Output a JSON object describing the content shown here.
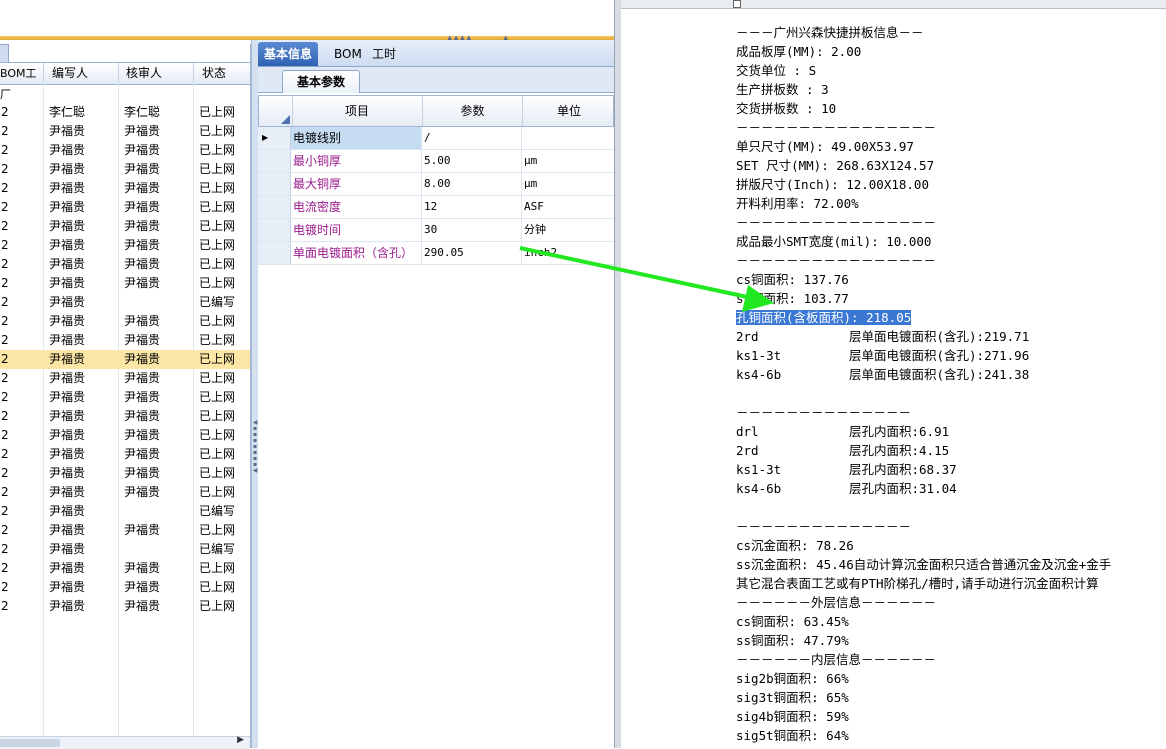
{
  "middle": {
    "tabs": [
      "基本信息",
      "BOM",
      "工时"
    ],
    "sub_tab": "基本参数",
    "grid_headers": [
      "项目",
      "参数",
      "单位"
    ],
    "rows": [
      {
        "item": "电镀线别",
        "value": "/",
        "unit": ""
      },
      {
        "item": "最小铜厚",
        "value": "5.00",
        "unit": "μm"
      },
      {
        "item": "最大铜厚",
        "value": "8.00",
        "unit": "μm"
      },
      {
        "item": "电流密度",
        "value": "12",
        "unit": "ASF"
      },
      {
        "item": "电镀时间",
        "value": "30",
        "unit": "分钟"
      },
      {
        "item": "单面电镀面积（含孔）",
        "value": "290.05",
        "unit": "inch2"
      }
    ]
  },
  "left": {
    "headers": [
      "BOM工厂",
      "编写人",
      "核审人",
      "状态"
    ],
    "rows": [
      [
        "2",
        "李仁聪",
        "李仁聪",
        "已上网"
      ],
      [
        "2",
        "尹福贵",
        "尹福贵",
        "已上网"
      ],
      [
        "2",
        "尹福贵",
        "尹福贵",
        "已上网"
      ],
      [
        "2",
        "尹福贵",
        "尹福贵",
        "已上网"
      ],
      [
        "2",
        "尹福贵",
        "尹福贵",
        "已上网"
      ],
      [
        "2",
        "尹福贵",
        "尹福贵",
        "已上网"
      ],
      [
        "2",
        "尹福贵",
        "尹福贵",
        "已上网"
      ],
      [
        "2",
        "尹福贵",
        "尹福贵",
        "已上网"
      ],
      [
        "2",
        "尹福贵",
        "尹福贵",
        "已上网"
      ],
      [
        "2",
        "尹福贵",
        "尹福贵",
        "已上网"
      ],
      [
        "2",
        "尹福贵",
        "",
        "已编写"
      ],
      [
        "2",
        "尹福贵",
        "尹福贵",
        "已上网"
      ],
      [
        "2",
        "尹福贵",
        "尹福贵",
        "已上网"
      ],
      [
        "2",
        "尹福贵",
        "尹福贵",
        "已上网"
      ],
      [
        "2",
        "尹福贵",
        "尹福贵",
        "已上网"
      ],
      [
        "2",
        "尹福贵",
        "尹福贵",
        "已上网"
      ],
      [
        "2",
        "尹福贵",
        "尹福贵",
        "已上网"
      ],
      [
        "2",
        "尹福贵",
        "尹福贵",
        "已上网"
      ],
      [
        "2",
        "尹福贵",
        "尹福贵",
        "已上网"
      ],
      [
        "2",
        "尹福贵",
        "尹福贵",
        "已上网"
      ],
      [
        "2",
        "尹福贵",
        "尹福贵",
        "已上网"
      ],
      [
        "2",
        "尹福贵",
        "",
        "已编写"
      ],
      [
        "2",
        "尹福贵",
        "尹福贵",
        "已上网"
      ],
      [
        "2",
        "尹福贵",
        "",
        "已编写"
      ],
      [
        "2",
        "尹福贵",
        "尹福贵",
        "已上网"
      ],
      [
        "2",
        "尹福贵",
        "尹福贵",
        "已上网"
      ],
      [
        "2",
        "尹福贵",
        "尹福贵",
        "已上网"
      ]
    ],
    "selected_row": 13
  },
  "report": {
    "lines": [
      {
        "text": "－－－广州兴森快捷拼板信息－－"
      },
      {
        "text": "成品板厚(MM): 2.00"
      },
      {
        "text": "交货单位 : S"
      },
      {
        "text": "生产拼板数 : 3"
      },
      {
        "text": "交货拼板数 : 10"
      },
      {
        "text": "－－－－－－－－－－－－－－－－"
      },
      {
        "text": "单只尺寸(MM): 49.00X53.97"
      },
      {
        "text": "SET 尺寸(MM): 268.63X124.57"
      },
      {
        "text": "拼版尺寸(Inch): 12.00X18.00"
      },
      {
        "text": "开料利用率: 72.00%"
      },
      {
        "text": "－－－－－－－－－－－－－－－－"
      },
      {
        "text": "成品最小SMT宽度(mil): 10.000"
      },
      {
        "text": "－－－－－－－－－－－－－－－－"
      },
      {
        "text": "cs铜面积: 137.76"
      },
      {
        "text": "ss铜面积: 103.77"
      },
      {
        "text": "孔铜面积(含板面积): 218.05",
        "highlight": true
      },
      {
        "k": "2rd",
        "v": "层单面电镀面积(含孔):219.71"
      },
      {
        "k": "ks1-3t",
        "v": "层单面电镀面积(含孔):271.96"
      },
      {
        "k": "ks4-6b",
        "v": "层单面电镀面积(含孔):241.38"
      },
      {
        "text": ""
      },
      {
        "text": "－－－－－－－－－－－－－－"
      },
      {
        "k": "drl",
        "v": "层孔内面积:6.91"
      },
      {
        "k": "2rd",
        "v": "层孔内面积:4.15"
      },
      {
        "k": "ks1-3t",
        "v": "层孔内面积:68.37"
      },
      {
        "k": "ks4-6b",
        "v": "层孔内面积:31.04"
      },
      {
        "text": ""
      },
      {
        "text": "－－－－－－－－－－－－－－"
      },
      {
        "text": "cs沉金面积: 78.26"
      },
      {
        "text": "ss沉金面积: 45.46自动计算沉金面积只适合普通沉金及沉金+金手"
      },
      {
        "text": "其它混合表面工艺或有PTH阶梯孔/槽时,请手动进行沉金面积计算"
      },
      {
        "text": "－－－－－－外层信息－－－－－－"
      },
      {
        "text": "cs铜面积: 63.45%"
      },
      {
        "text": "ss铜面积: 47.79%"
      },
      {
        "text": "－－－－－－内层信息－－－－－－"
      },
      {
        "text": "sig2b铜面积: 66%"
      },
      {
        "text": "sig3t铜面积: 65%"
      },
      {
        "text": "sig4b铜面积: 59%"
      },
      {
        "text": "sig5t铜面积: 64%"
      }
    ]
  },
  "colors": {
    "arrow": "#22e822",
    "selection": "#3a78d4",
    "selected_row": "#fbe6a6",
    "item_text": "#9a1c8c"
  }
}
